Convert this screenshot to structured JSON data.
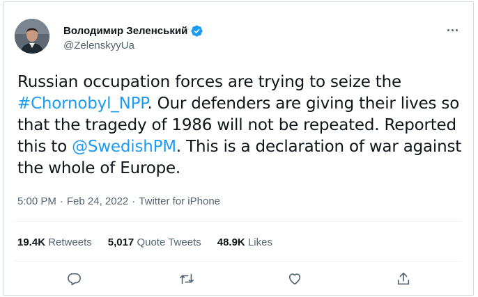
{
  "author": {
    "display_name": "Володимир Зеленський",
    "handle": "@ZelenskyyUa",
    "verified": true
  },
  "tweet": {
    "text_1": "Russian occupation forces are trying to seize the ",
    "hashtag": "#Chornobyl_NPP",
    "text_2": ". Our defenders are giving their lives so that the tragedy of 1986 will not be repeated. Reported this to ",
    "mention": "@SwedishPM",
    "text_3": ". This is a declaration of war against the whole of Europe."
  },
  "meta": {
    "time": "5:00 PM",
    "date": "Feb 24, 2022",
    "source": "Twitter for iPhone",
    "separator": "·"
  },
  "stats": {
    "retweets_count": "19.4K",
    "retweets_label": "Retweets",
    "quotes_count": "5,017",
    "quotes_label": "Quote Tweets",
    "likes_count": "48.9K",
    "likes_label": "Likes"
  },
  "icons": {
    "more": "more-horizontal-icon",
    "reply": "reply-icon",
    "retweet": "retweet-icon",
    "like": "heart-icon",
    "share": "share-icon",
    "verified": "verified-badge-icon"
  },
  "colors": {
    "link": "#1d9bf0",
    "text": "#0f1419",
    "secondary": "#536471",
    "border": "#cfd9de"
  }
}
